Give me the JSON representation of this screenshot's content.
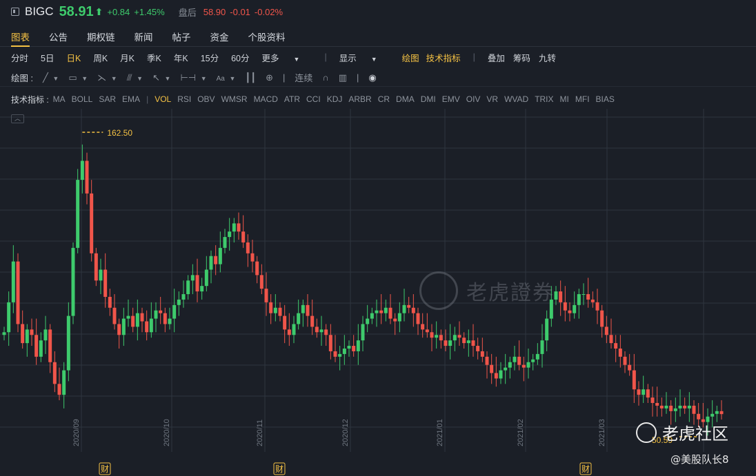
{
  "quote": {
    "ticker": "BIGC",
    "price": "58.91",
    "arrow": "⬆",
    "change": "+0.84",
    "change_pct": "+1.45%",
    "after_hours_label": "盘后",
    "after_hours_price": "58.90",
    "after_hours_change": "-0.01",
    "after_hours_pct": "-0.02%"
  },
  "tabs": [
    "图表",
    "公告",
    "期权链",
    "新闻",
    "帖子",
    "资金",
    "个股资料"
  ],
  "periods": {
    "items": [
      "分时",
      "5日",
      "日K",
      "周K",
      "月K",
      "季K",
      "年K",
      "15分",
      "60分"
    ],
    "more": "更多",
    "display": "显示",
    "draw": "绘图",
    "tech": "技术指标",
    "overlay": "叠加",
    "chips": "筹码",
    "nine": "九转"
  },
  "draw_tools": {
    "label": "绘图 :",
    "continuous": "连续",
    "text_tool": "Aa"
  },
  "indicators": {
    "label": "技术指标 :",
    "main": [
      "MA",
      "BOLL",
      "SAR",
      "EMA"
    ],
    "sub": [
      "VOL",
      "RSI",
      "OBV",
      "WMSR",
      "MACD",
      "ATR",
      "CCI",
      "KDJ",
      "ARBR",
      "CR",
      "DMA",
      "DMI",
      "EMV",
      "OIV",
      "VR",
      "WVAD",
      "TRIX",
      "MI",
      "MFI",
      "BIAS"
    ]
  },
  "chart_data": {
    "type": "candlestick",
    "x_tick_labels": [
      "2020/09",
      "2020/10",
      "2020/11",
      "2020/12",
      "2021/01",
      "2021/02",
      "2021/03"
    ],
    "high_marker": "162.50",
    "low_marker": "50.59",
    "earnings_marker": "财",
    "colors": {
      "up": "#3ecb6c",
      "down": "#f0554a",
      "grid": "#2f353f",
      "marker": "#f5c244"
    },
    "closes": [
      89,
      100,
      115,
      92,
      85,
      90,
      88,
      80,
      86,
      90,
      78,
      70,
      66,
      75,
      95,
      120,
      145,
      152,
      140,
      118,
      108,
      112,
      102,
      98,
      92,
      88,
      94,
      95,
      91,
      96,
      93,
      89,
      94,
      97,
      96,
      92,
      94,
      99,
      101,
      103,
      108,
      110,
      104,
      106,
      112,
      117,
      114,
      120,
      124,
      126,
      129,
      126,
      122,
      118,
      115,
      110,
      105,
      100,
      96,
      98,
      95,
      90,
      88,
      92,
      96,
      99,
      95,
      91,
      89,
      90,
      88,
      82,
      80,
      81,
      83,
      84,
      82,
      86,
      92,
      94,
      96,
      97,
      96,
      98,
      94,
      93,
      96,
      99,
      98,
      96,
      92,
      90,
      89,
      87,
      88,
      86,
      84,
      86,
      88,
      87,
      85,
      86,
      84,
      82,
      80,
      77,
      74,
      72,
      75,
      76,
      78,
      80,
      77,
      76,
      78,
      79,
      81,
      86,
      94,
      101,
      104,
      100,
      97,
      96,
      99,
      103,
      103,
      101,
      100,
      97,
      91,
      88,
      85,
      83,
      80,
      77,
      75,
      68,
      66,
      68,
      65,
      63,
      62,
      61,
      62,
      60,
      61,
      62,
      61,
      62,
      59,
      57,
      56,
      58,
      59,
      60,
      58.91
    ]
  },
  "watermark": {
    "text": "老虎證券"
  },
  "forum": {
    "name": "老虎社区",
    "credit": "@美股队长8"
  }
}
